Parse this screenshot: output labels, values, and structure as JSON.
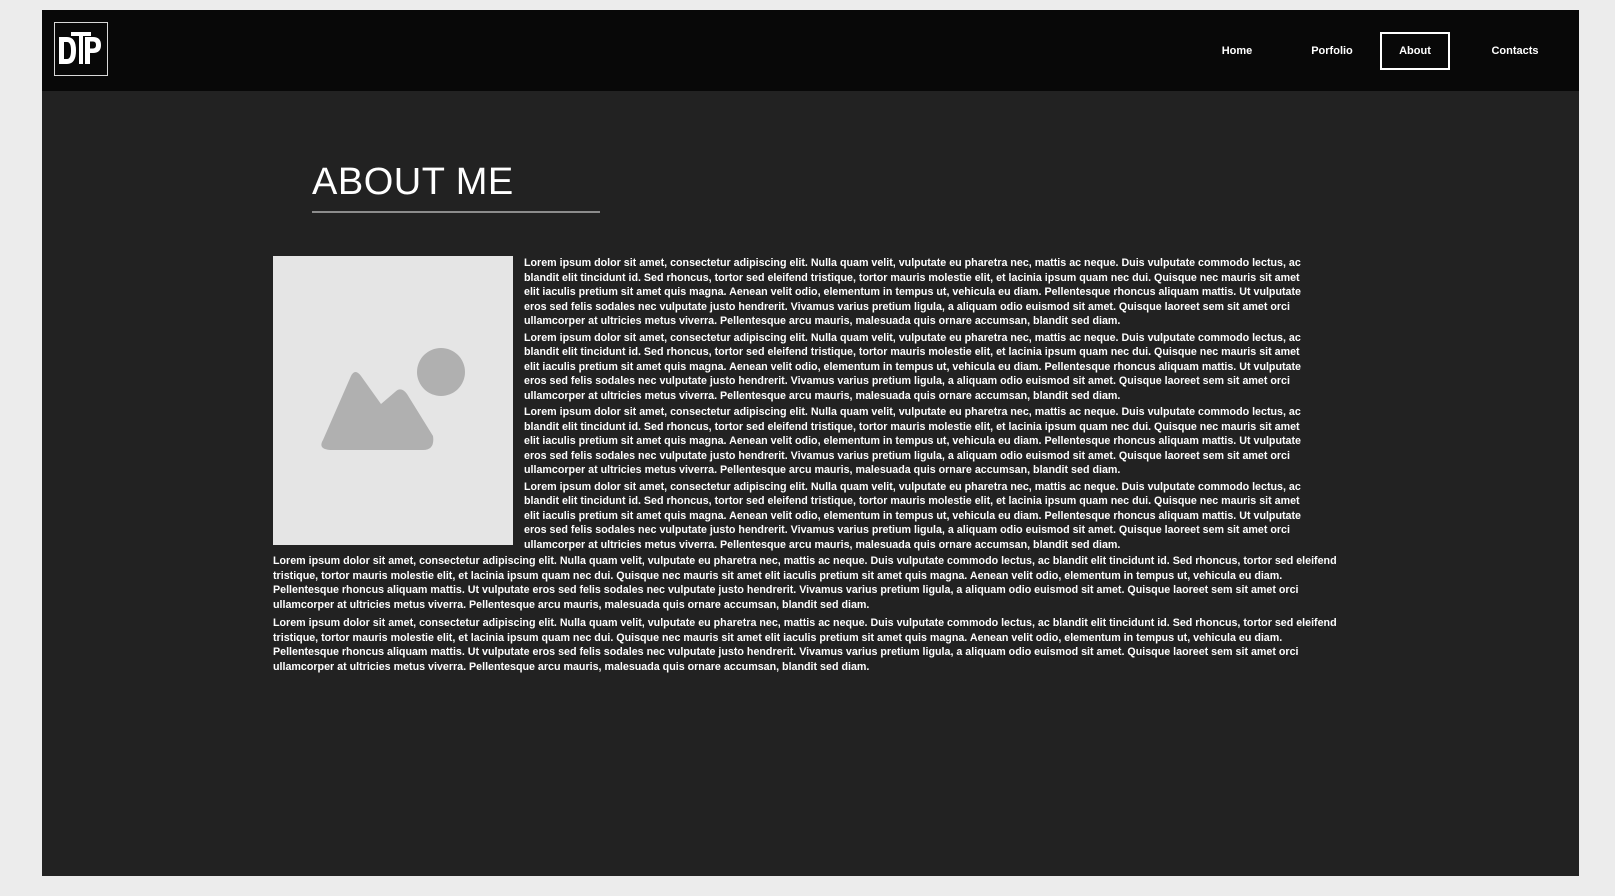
{
  "header": {
    "logo": {
      "text": "DTP",
      "icon": "dtp-logo-icon"
    },
    "nav": [
      {
        "label": "Home",
        "active": false
      },
      {
        "label": "Porfolio",
        "active": false
      },
      {
        "label": "About",
        "active": true
      },
      {
        "label": "Contacts",
        "active": false
      }
    ]
  },
  "main": {
    "title": "ABOUT ME",
    "image": {
      "icon": "image-placeholder-icon"
    },
    "paragraphs": [
      "Lorem ipsum dolor sit amet, consectetur adipiscing elit. Nulla quam velit, vulputate eu pharetra nec, mattis ac neque. Duis vulputate commodo lectus, ac blandit elit tincidunt id. Sed rhoncus, tortor sed eleifend tristique, tortor mauris molestie elit, et lacinia ipsum quam nec dui. Quisque nec mauris sit amet elit iaculis pretium sit amet quis magna. Aenean velit odio, elementum in tempus ut, vehicula eu diam. Pellentesque rhoncus aliquam mattis. Ut vulputate eros sed felis sodales nec vulputate justo hendrerit. Vivamus varius pretium ligula, a aliquam odio euismod sit amet. Quisque laoreet sem sit amet orci ullamcorper at ultricies metus viverra. Pellentesque arcu mauris, malesuada quis ornare accumsan, blandit sed diam.",
      "Lorem ipsum dolor sit amet, consectetur adipiscing elit. Nulla quam velit, vulputate eu pharetra nec, mattis ac neque. Duis vulputate commodo lectus, ac blandit elit tincidunt id. Sed rhoncus, tortor sed eleifend tristique, tortor mauris molestie elit, et lacinia ipsum quam nec dui. Quisque nec mauris sit amet elit iaculis pretium sit amet quis magna. Aenean velit odio, elementum in tempus ut, vehicula eu diam. Pellentesque rhoncus aliquam mattis. Ut vulputate eros sed felis sodales nec vulputate justo hendrerit. Vivamus varius pretium ligula, a aliquam odio euismod sit amet. Quisque laoreet sem sit amet orci ullamcorper at ultricies metus viverra. Pellentesque arcu mauris, malesuada quis ornare accumsan, blandit sed diam.",
      "Lorem ipsum dolor sit amet, consectetur adipiscing elit. Nulla quam velit, vulputate eu pharetra nec, mattis ac neque. Duis vulputate commodo lectus, ac blandit elit tincidunt id. Sed rhoncus, tortor sed eleifend tristique, tortor mauris molestie elit, et lacinia ipsum quam nec dui. Quisque nec mauris sit amet elit iaculis pretium sit amet quis magna. Aenean velit odio, elementum in tempus ut, vehicula eu diam. Pellentesque rhoncus aliquam mattis. Ut vulputate eros sed felis sodales nec vulputate justo hendrerit. Vivamus varius pretium ligula, a aliquam odio euismod sit amet. Quisque laoreet sem sit amet orci ullamcorper at ultricies metus viverra. Pellentesque arcu mauris, malesuada quis ornare accumsan, blandit sed diam.",
      "Lorem ipsum dolor sit amet, consectetur adipiscing elit. Nulla quam velit, vulputate eu pharetra nec, mattis ac neque. Duis vulputate commodo lectus, ac blandit elit tincidunt id. Sed rhoncus, tortor sed eleifend tristique, tortor mauris molestie elit, et lacinia ipsum quam nec dui. Quisque nec mauris sit amet elit iaculis pretium sit amet quis magna. Aenean velit odio, elementum in tempus ut, vehicula eu diam. Pellentesque rhoncus aliquam mattis. Ut vulputate eros sed felis sodales nec vulputate justo hendrerit. Vivamus varius pretium ligula, a aliquam odio euismod sit amet. Quisque laoreet sem sit amet orci ullamcorper at ultricies metus viverra. Pellentesque arcu mauris, malesuada quis ornare accumsan, blandit sed diam.",
      "Lorem ipsum dolor sit amet, consectetur adipiscing elit. Nulla quam velit, vulputate eu pharetra nec, mattis ac neque. Duis vulputate commodo lectus, ac blandit elit tincidunt id. Sed rhoncus, tortor sed eleifend tristique, tortor mauris molestie elit, et lacinia ipsum quam nec dui. Quisque nec mauris sit amet elit iaculis pretium sit amet quis magna. Aenean velit odio, elementum in tempus ut, vehicula eu diam. Pellentesque rhoncus aliquam mattis. Ut vulputate eros sed felis sodales nec vulputate justo hendrerit. Vivamus varius pretium ligula, a aliquam odio euismod sit amet. Quisque laoreet sem sit amet orci ullamcorper at ultricies metus viverra. Pellentesque arcu mauris, malesuada quis ornare accumsan, blandit sed diam.",
      "Lorem ipsum dolor sit amet, consectetur adipiscing elit. Nulla quam velit, vulputate eu pharetra nec, mattis ac neque. Duis vulputate commodo lectus, ac blandit elit tincidunt id. Sed rhoncus, tortor sed eleifend tristique, tortor mauris molestie elit, et lacinia ipsum quam nec dui. Quisque nec mauris sit amet elit iaculis pretium sit amet quis magna. Aenean velit odio, elementum in tempus ut, vehicula eu diam. Pellentesque rhoncus aliquam mattis. Ut vulputate eros sed felis sodales nec vulputate justo hendrerit. Vivamus varius pretium ligula, a aliquam odio euismod sit amet. Quisque laoreet sem sit amet orci ullamcorper at ultricies metus viverra. Pellentesque arcu mauris, malesuada quis ornare accumsan, blandit sed diam."
    ]
  },
  "colors": {
    "page_background": "#222222",
    "header_background": "#080808",
    "outer_background": "#ececec",
    "text": "#ffffff",
    "image_placeholder": "#e5e5e5",
    "image_glyph": "#b0b0b0"
  }
}
